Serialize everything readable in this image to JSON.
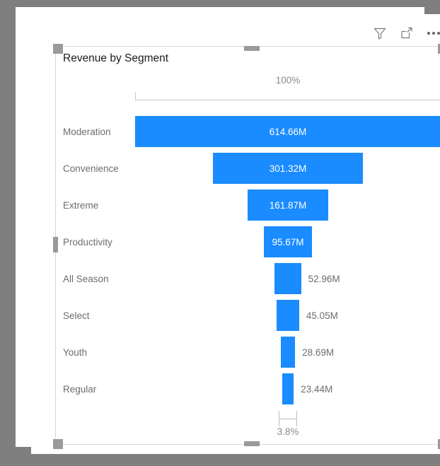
{
  "header": {
    "icons": [
      {
        "name": "filter-icon",
        "glyph": "funnel"
      },
      {
        "name": "focus-mode-icon",
        "glyph": "expand"
      },
      {
        "name": "more-options-icon",
        "glyph": "ellipsis"
      }
    ]
  },
  "visual": {
    "title": "Revenue by Segment",
    "accent_color": "#1a8cff",
    "label_color": "#6d6d6d",
    "axis_color": "#8a8a8a"
  },
  "chart_data": {
    "type": "bar",
    "chart_subtype": "funnel",
    "title": "Revenue by Segment",
    "xlabel": "",
    "ylabel": "",
    "categories": [
      "Moderation",
      "Convenience",
      "Extreme",
      "Productivity",
      "All Season",
      "Select",
      "Youth",
      "Regular"
    ],
    "values": [
      614.66,
      301.32,
      161.87,
      95.67,
      52.96,
      45.05,
      28.69,
      23.44
    ],
    "value_labels": [
      "614.66M",
      "301.32M",
      "161.87M",
      "95.67M",
      "52.96M",
      "45.05M",
      "28.69M",
      "23.44M"
    ],
    "value_unit": "M",
    "label_placement": [
      "inside",
      "inside",
      "inside",
      "inside",
      "outside",
      "outside",
      "outside",
      "outside"
    ],
    "top_percent_label": "100%",
    "conversion_rate_label": "3.8%",
    "grid": false,
    "legend": "none",
    "series": [
      {
        "name": "Revenue",
        "values": [
          614.66,
          301.32,
          161.87,
          95.67,
          52.96,
          45.05,
          28.69,
          23.44
        ]
      }
    ]
  }
}
